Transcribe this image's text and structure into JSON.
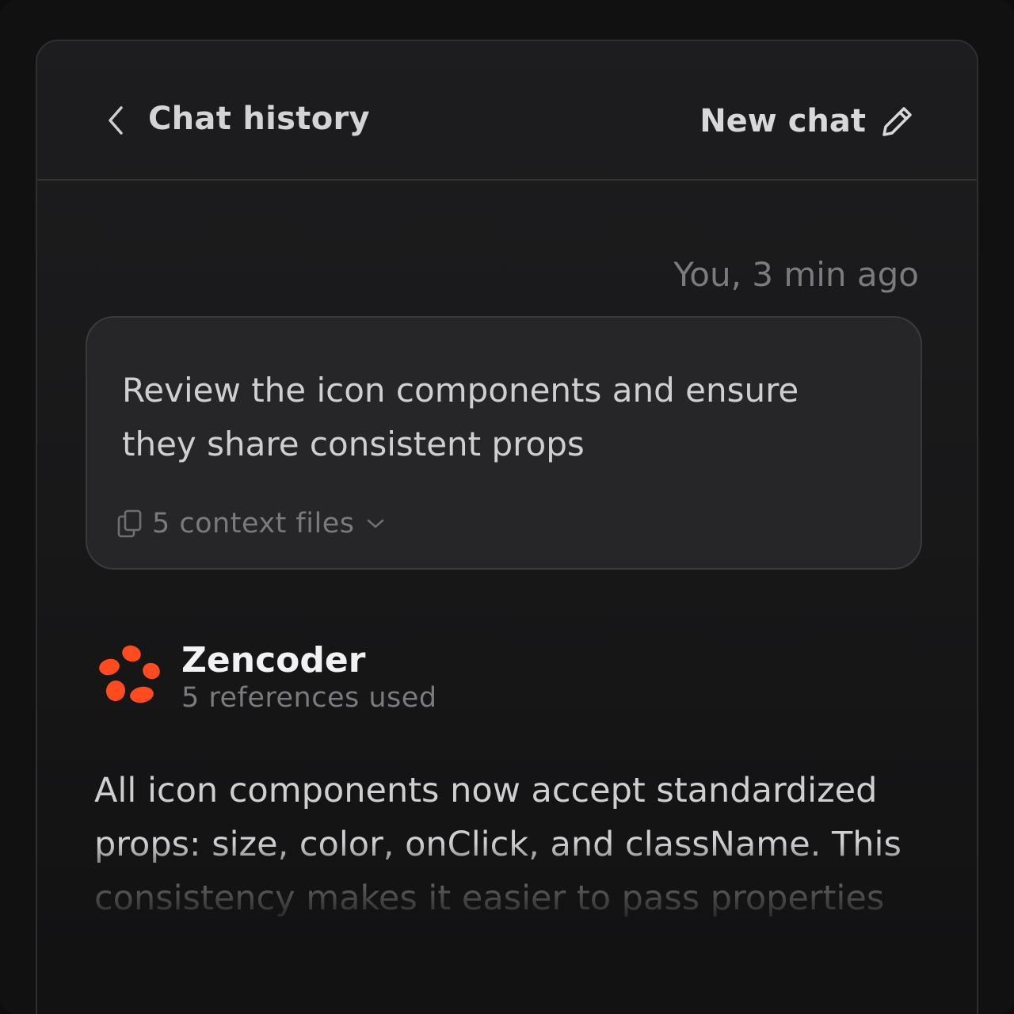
{
  "header": {
    "back_icon": "chevron-left-icon",
    "title": "Chat history",
    "new_chat_label": "New chat",
    "new_chat_icon": "pencil-icon"
  },
  "user_message": {
    "meta": "You, 3 min ago",
    "text": "Review the icon components and ensure they share consistent props",
    "context": {
      "icon": "files-icon",
      "label": "5 context files",
      "expand_icon": "chevron-down-icon"
    }
  },
  "agent": {
    "logo_icon": "zencoder-logo-icon",
    "name": "Zencoder",
    "references": "5 references used",
    "brand_color": "#ff4b1f",
    "response": "All icon components now accept standardized props: size, color, onClick, and className. This consistency makes it easier to pass properties"
  }
}
